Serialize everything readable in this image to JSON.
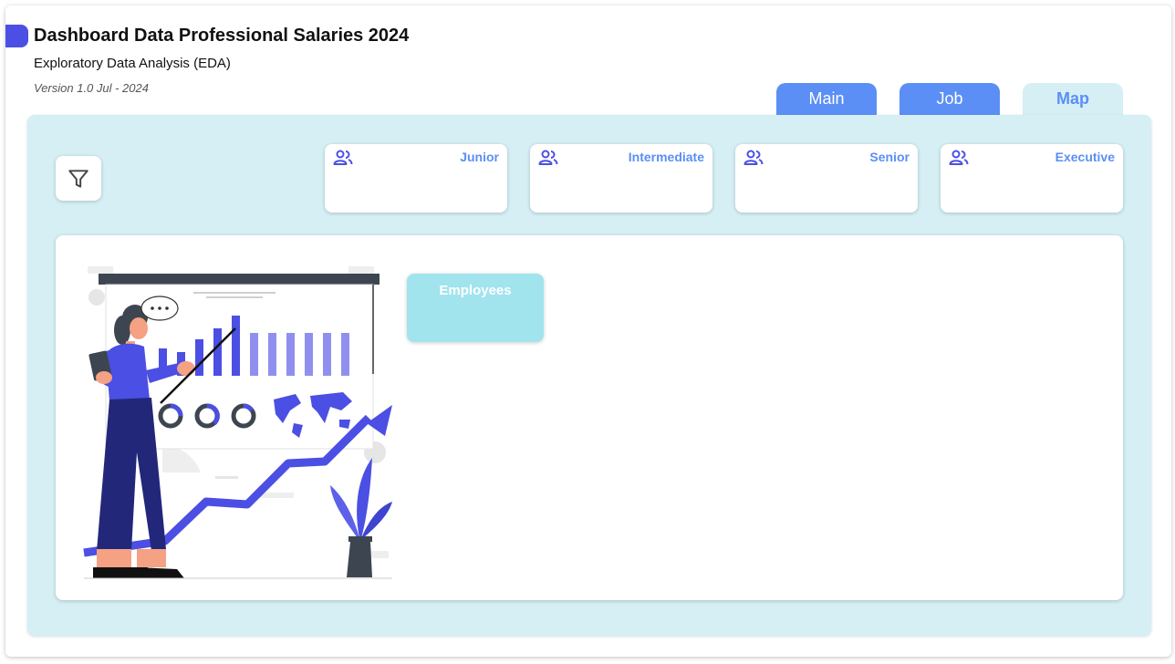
{
  "header": {
    "title": "Dashboard Data Professional Salaries 2024",
    "subtitle": "Exploratory Data Analysis (EDA)",
    "version": "Version 1.0 Jul - 2024"
  },
  "tabs": [
    {
      "label": "Main",
      "active": false
    },
    {
      "label": "Job",
      "active": false
    },
    {
      "label": "Map",
      "active": true
    }
  ],
  "filter": {
    "icon": "filter-icon"
  },
  "level_cards": [
    {
      "label": "Junior",
      "icon": "people-icon"
    },
    {
      "label": "Intermediate",
      "icon": "people-icon"
    },
    {
      "label": "Senior",
      "icon": "people-icon"
    },
    {
      "label": "Executive",
      "icon": "people-icon"
    }
  ],
  "kpi": {
    "employees_label": "Employees"
  },
  "colors": {
    "accent": "#4b4fe3",
    "tab_blue": "#5b8ff5",
    "panel_bg": "#d5eff4",
    "kpi_bg": "#a2e4ee"
  }
}
